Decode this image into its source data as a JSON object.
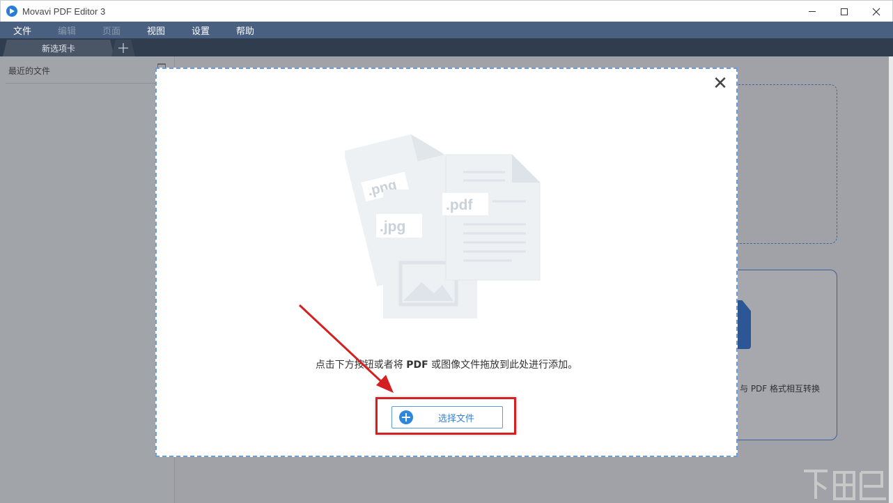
{
  "window": {
    "title": "Movavi PDF Editor 3"
  },
  "menu": {
    "items": [
      {
        "label": "文件",
        "enabled": true
      },
      {
        "label": "编辑",
        "enabled": false
      },
      {
        "label": "页面",
        "enabled": false
      },
      {
        "label": "视图",
        "enabled": true
      },
      {
        "label": "设置",
        "enabled": true
      },
      {
        "label": "帮助",
        "enabled": true
      }
    ]
  },
  "tabs": {
    "active_label": "新选项卡",
    "add_label": "+"
  },
  "sidebar": {
    "recent_title": "最近的文件"
  },
  "background": {
    "card_text": "与 PDF 格式相互转换"
  },
  "dialog": {
    "close_label": "✕",
    "file_types": [
      ".png",
      ".jpg",
      ".pdf"
    ],
    "instruction_part1": "点击下方按钮或者将 ",
    "instruction_pdf": "PDF",
    "instruction_part2": " 或图像文件拖放到此处进行添加。",
    "choose_button_label": "选择文件"
  },
  "colors": {
    "menu_bg": "#4a6080",
    "tabbar_bg": "#2f3d4e",
    "accent_blue": "#2e86de",
    "highlight_red": "#d42020"
  }
}
